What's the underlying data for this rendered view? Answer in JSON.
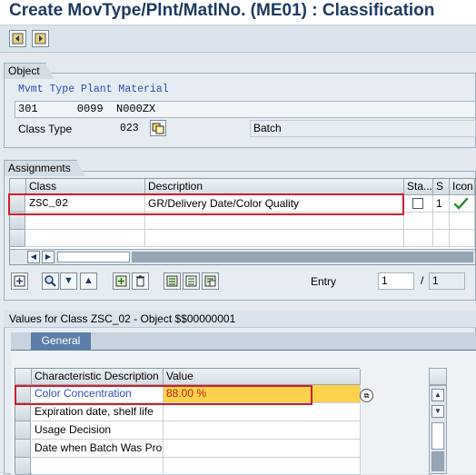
{
  "window": {
    "title": "Create MovType/Plnt/MatlNo. (ME01) : Classification"
  },
  "toolbar": {
    "btn1_icon": "prev-screen-icon",
    "btn2_icon": "next-screen-icon"
  },
  "object": {
    "tab_label": "Object",
    "header_text": "Mvmt Type Plant Material",
    "values_text": "301      0099  N000ZX",
    "class_type_label": "Class Type",
    "class_type_value": "023",
    "class_type_text": "Batch"
  },
  "assignments": {
    "tab_label": "Assignments",
    "columns": [
      "Class",
      "Description",
      "Sta...",
      "S",
      "Icon"
    ],
    "rows": [
      {
        "class": "ZSC_02",
        "description": "GR/Delivery Date/Color Quality",
        "status_checked": false,
        "s": "1",
        "icon": "check-icon"
      }
    ],
    "entry_label": "Entry",
    "entry_value": "1",
    "entry_sep": "/",
    "entry_total": "1"
  },
  "values": {
    "section_title": "Values for Class ZSC_02 - Object $$00000001",
    "tab_general": "General",
    "columns": [
      "Characteristic Description",
      "Value"
    ],
    "rows": [
      {
        "description": "Color Concentration",
        "value": "88.00 %"
      },
      {
        "description": "Expiration date, shelf life",
        "value": ""
      },
      {
        "description": "Usage Decision",
        "value": ""
      },
      {
        "description": "Date when Batch Was Pro",
        "value": ""
      }
    ]
  },
  "colors": {
    "title": "#1f3b60",
    "highlight": "#d0202a",
    "value_field": "#fcd24c"
  }
}
